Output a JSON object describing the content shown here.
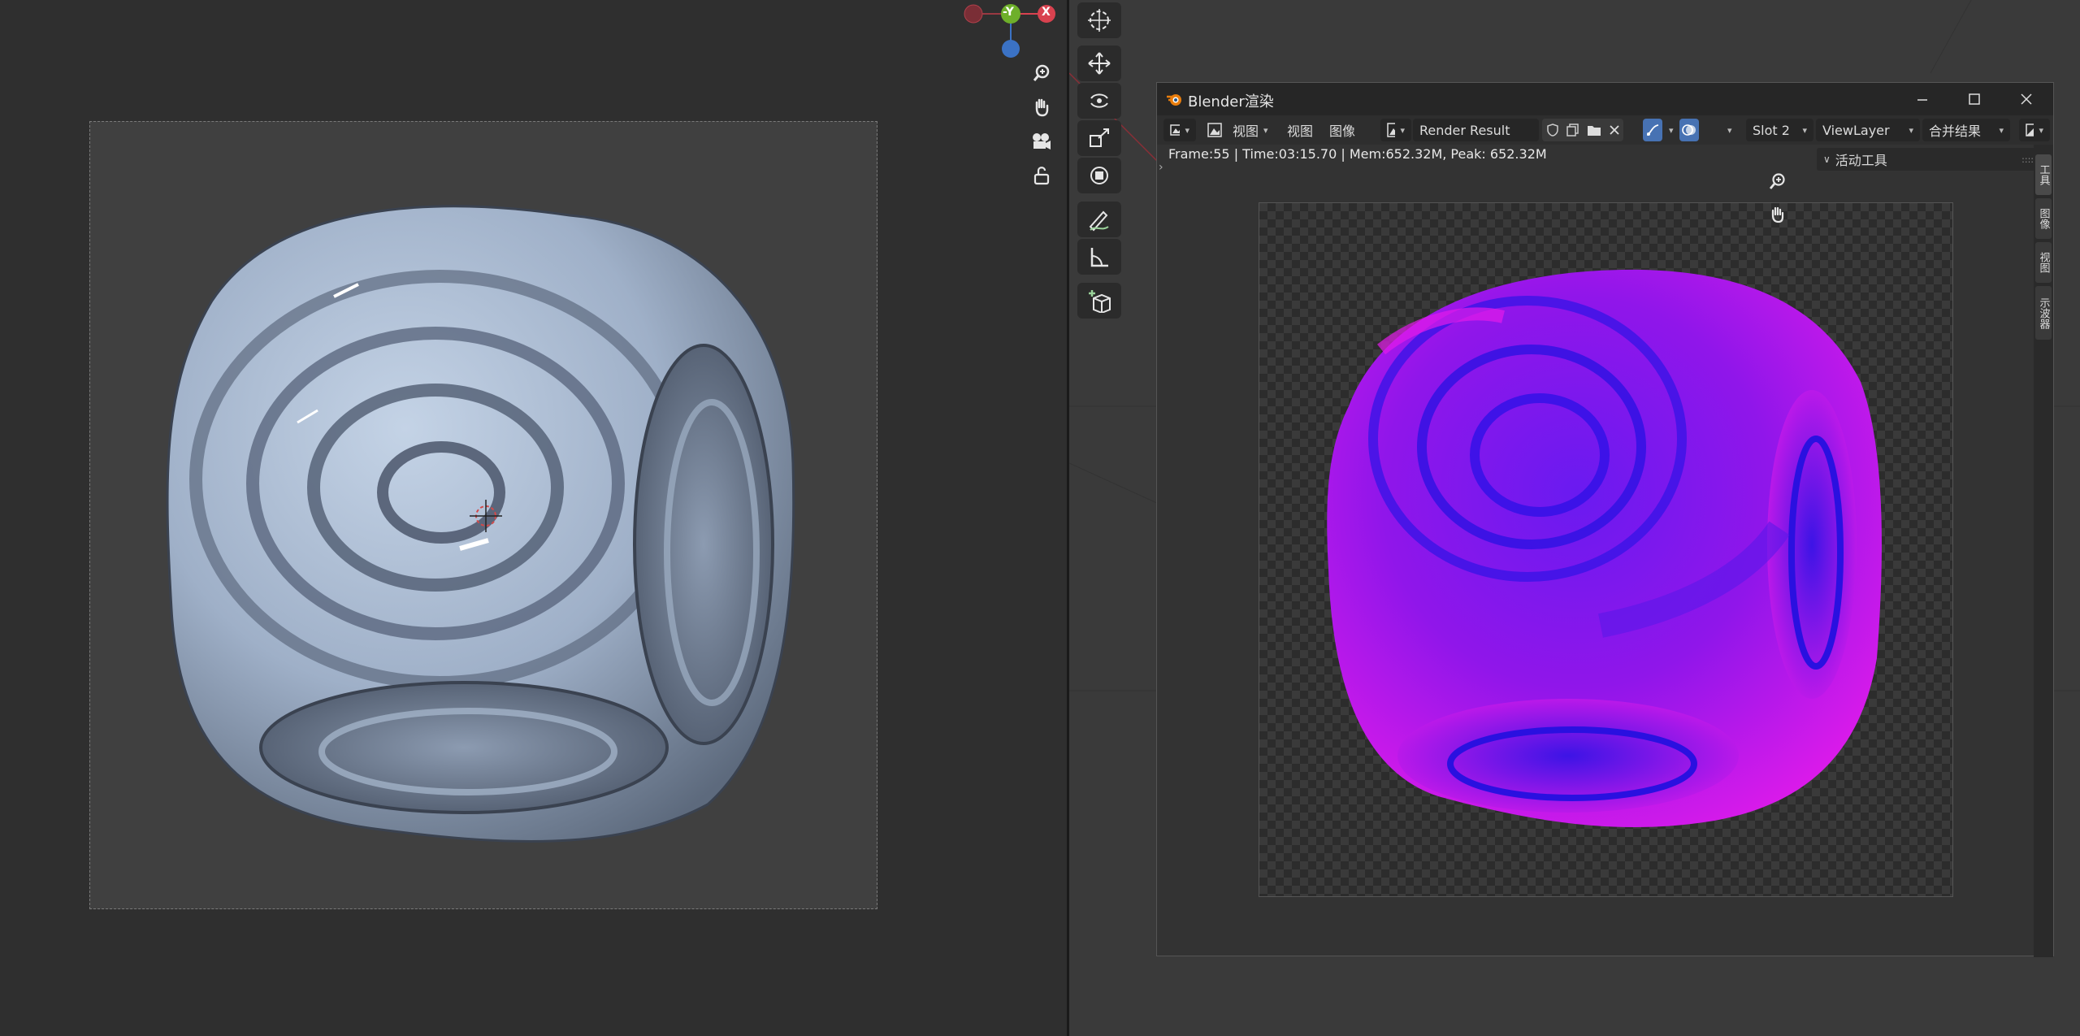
{
  "window": {
    "title": "Blender渲染",
    "minimize_icon": "minimize-icon",
    "maximize_icon": "maximize-icon",
    "close_icon": "close-icon"
  },
  "header": {
    "editor_type_icon": "image-editor-icon",
    "view_mode_icon": "view-mode-icon",
    "menu_view": "视图",
    "menu_view2": "视图",
    "menu_image": "图像",
    "image_name": "Render Result",
    "slot": "Slot 2",
    "view_layer": "ViewLayer",
    "pass": "合并结果"
  },
  "info": {
    "text": "Frame:55 | Time:03:15.70 | Mem:652.32M, Peak: 652.32M"
  },
  "sidebar": {
    "panel_title": "活动工具",
    "tabs": [
      "工具",
      "图像",
      "视图",
      "示波器"
    ]
  },
  "gizmo": {
    "axis_x": "X",
    "axis_y": "-Y",
    "colors": {
      "x": "#d9424f",
      "y": "#6eaf2a",
      "z": "#3b72c4"
    }
  },
  "colors": {
    "render_magenta": "#e21bea",
    "render_blue": "#3312e6",
    "viewport_object": "#a4b4cc"
  }
}
